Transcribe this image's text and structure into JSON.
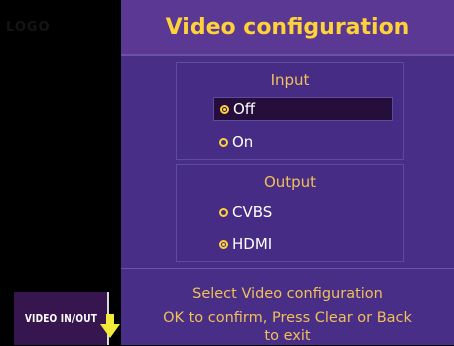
{
  "sidebar": {
    "logo_text": "LOGO",
    "active_tab_label": "VIDEO IN/OUT"
  },
  "header": {
    "title": "Video configuration"
  },
  "input": {
    "title": "Input",
    "options": [
      "Off",
      "On"
    ],
    "selected": "Off"
  },
  "output": {
    "title": "Output",
    "options": [
      "CVBS",
      "HDMI"
    ],
    "selected": "HDMI"
  },
  "footer": {
    "line1": "Select Video configuration",
    "line2": "OK to confirm, Press Clear or Back",
    "line3": "to exit"
  },
  "colors": {
    "panel": "#482e86",
    "accent": "#ffd23a",
    "highlight": "#250e3c"
  },
  "icons": {
    "scroll": "down-arrow-icon"
  }
}
